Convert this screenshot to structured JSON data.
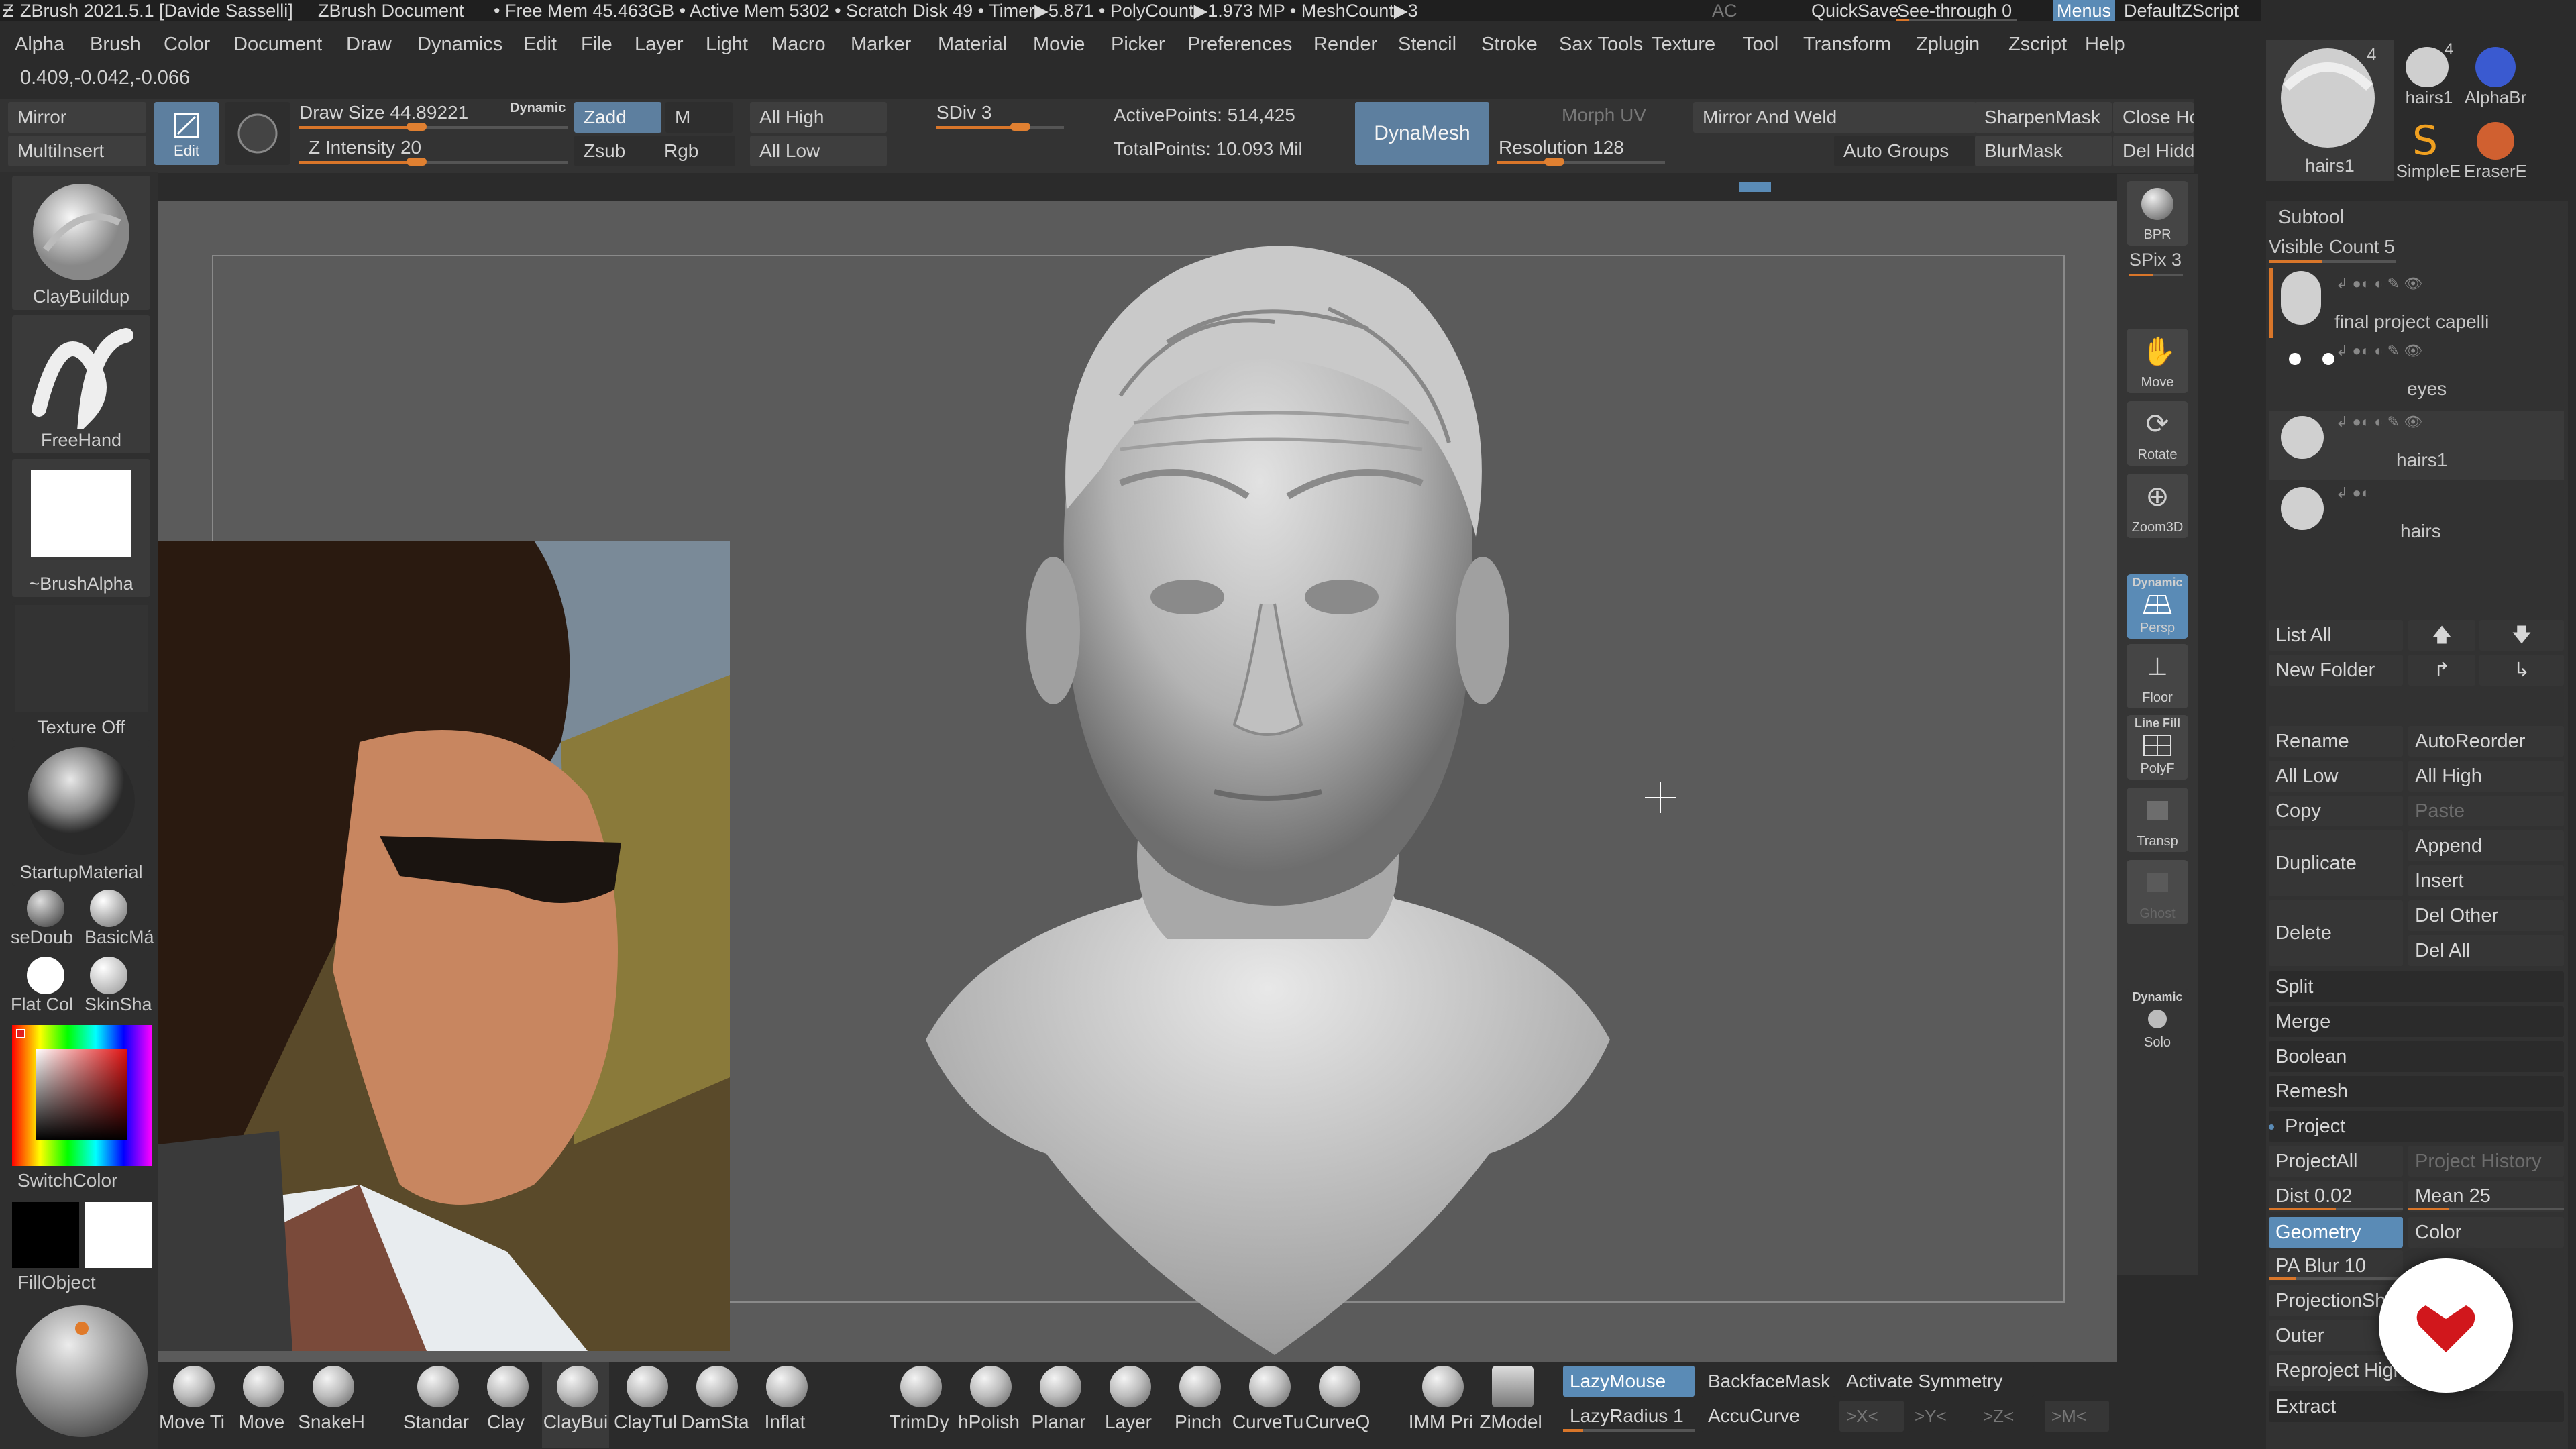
{
  "titlebar": {
    "app": "ZBrush 2021.5.1 [Davide Sasselli]",
    "document": "ZBrush Document",
    "stats": "• Free Mem 45.463GB • Active Mem 5302 • Scratch Disk 49 • Timer▶5.871 • PolyCount▶1.973 MP • MeshCount▶3",
    "ac": "AC",
    "quicksave": "QuickSave",
    "seethrough": "See-through  0",
    "menus": "Menus",
    "script": "DefaultZScript"
  },
  "menubar": [
    "Alpha",
    "Brush",
    "Color",
    "Document",
    "Draw",
    "Dynamics",
    "Edit",
    "File",
    "Layer",
    "Light",
    "Macro",
    "Marker",
    "Material",
    "Movie",
    "Picker",
    "Preferences",
    "Render",
    "Stencil",
    "Stroke",
    "Sax Tools",
    "Texture",
    "Tool",
    "Transform",
    "Zplugin",
    "Zscript",
    "Help"
  ],
  "coords": "0.409,-0.042,-0.066",
  "shelf": {
    "mirror": "Mirror",
    "multiinsert": "MultiInsert",
    "edit": "Edit",
    "draw_size_label": "Draw Size",
    "draw_size": "44.89221",
    "dynamic": "Dynamic",
    "z_intensity_label": "Z Intensity",
    "z_intensity": "20",
    "zadd": "Zadd",
    "zsub": "Zsub",
    "m": "M",
    "rgb": "Rgb",
    "all_high": "All High",
    "all_low": "All Low",
    "sdiv_label": "SDiv",
    "sdiv": "3",
    "active_points": "ActivePoints: 514,425",
    "total_points": "TotalPoints: 10.093 Mil",
    "dynamesh": "DynaMesh",
    "morph_uv": "Morph UV",
    "resolution_label": "Resolution",
    "resolution": "128",
    "mirror_weld": "Mirror And Weld",
    "auto_groups": "Auto Groups",
    "sharpen_mask": "SharpenMask",
    "blur_mask": "BlurMask",
    "close_holes": "Close Hc",
    "del_hidden": "Del Hidd"
  },
  "lefttray": {
    "brush": "ClayBuildup",
    "stroke": "FreeHand",
    "alpha": "~BrushAlpha",
    "texture": "Texture Off",
    "material": "StartupMaterial",
    "mat1": "seDoub",
    "mat2": "BasicMá",
    "mat3": "Flat Col",
    "mat4": "SkinSha",
    "switchcolor": "SwitchColor",
    "fillobject": "FillObject"
  },
  "dock": {
    "bpr": "BPR",
    "spix": "SPix 3",
    "move": "Move",
    "rotate": "Rotate",
    "zoom3d": "Zoom3D",
    "dynamic": "Dynamic",
    "persp": "Persp",
    "floor": "Floor",
    "linefill": "Line Fill",
    "polyf": "PolyF",
    "transp": "Transp",
    "ghost": "Ghost",
    "solo_dynamic": "Dynamic",
    "solo": "Solo"
  },
  "toolthumbs": {
    "t1": "hairs1",
    "t2": "hairs1",
    "t3": "AlphaBr",
    "t4": "SimpleE",
    "t5": "EraserE",
    "count1": "4",
    "count2": "4"
  },
  "subtool": {
    "header": "Subtool",
    "visible_count": "Visible Count 5",
    "items": [
      "final project capelli",
      "eyes",
      "hairs1",
      "hairs"
    ],
    "list_all": "List All",
    "new_folder": "New Folder",
    "rename": "Rename",
    "autoreorder": "AutoReorder",
    "all_low": "All Low",
    "all_high": "All High",
    "copy": "Copy",
    "paste": "Paste",
    "duplicate": "Duplicate",
    "append": "Append",
    "insert": "Insert",
    "delete": "Delete",
    "del_other": "Del Other",
    "del_all": "Del All",
    "split": "Split",
    "merge": "Merge",
    "boolean": "Boolean",
    "remesh": "Remesh",
    "project": "Project",
    "projectall": "ProjectAll",
    "project_history": "Project History",
    "dist": "Dist 0.02",
    "mean": "Mean 25",
    "geometry": "Geometry",
    "color": "Color",
    "pa_blur": "PA Blur 10",
    "projection_shell": "ProjectionShe",
    "outer": "Outer",
    "reproject_higher": "Reproject High",
    "extract": "Extract"
  },
  "bottom": {
    "brushes": [
      "Move T⁠i",
      "Move",
      "SnakeH",
      "Standar",
      "Clay",
      "ClayBui",
      "ClayTul",
      "DamSta",
      "Inflat",
      "TrimDy",
      "hPolish",
      "Planar",
      "Layer",
      "Pinch",
      "CurveT⁠u",
      "CurveQ",
      "IMM Pri",
      "ZModel"
    ],
    "lazymouse": "LazyMouse",
    "lazyradius": "LazyRadius 1",
    "backface": "BackfaceMask",
    "accucurve": "AccuCurve",
    "activate_symmetry": "Activate Symmetry",
    "x": ">X<",
    "y": ">Y<",
    "z": ">Z<",
    "m": ">M<"
  },
  "colors": {
    "accent": "#d9762a",
    "active_blue": "#5d7f9f",
    "canvas": "#5b5b5b",
    "logo_red": "#d1171c"
  }
}
